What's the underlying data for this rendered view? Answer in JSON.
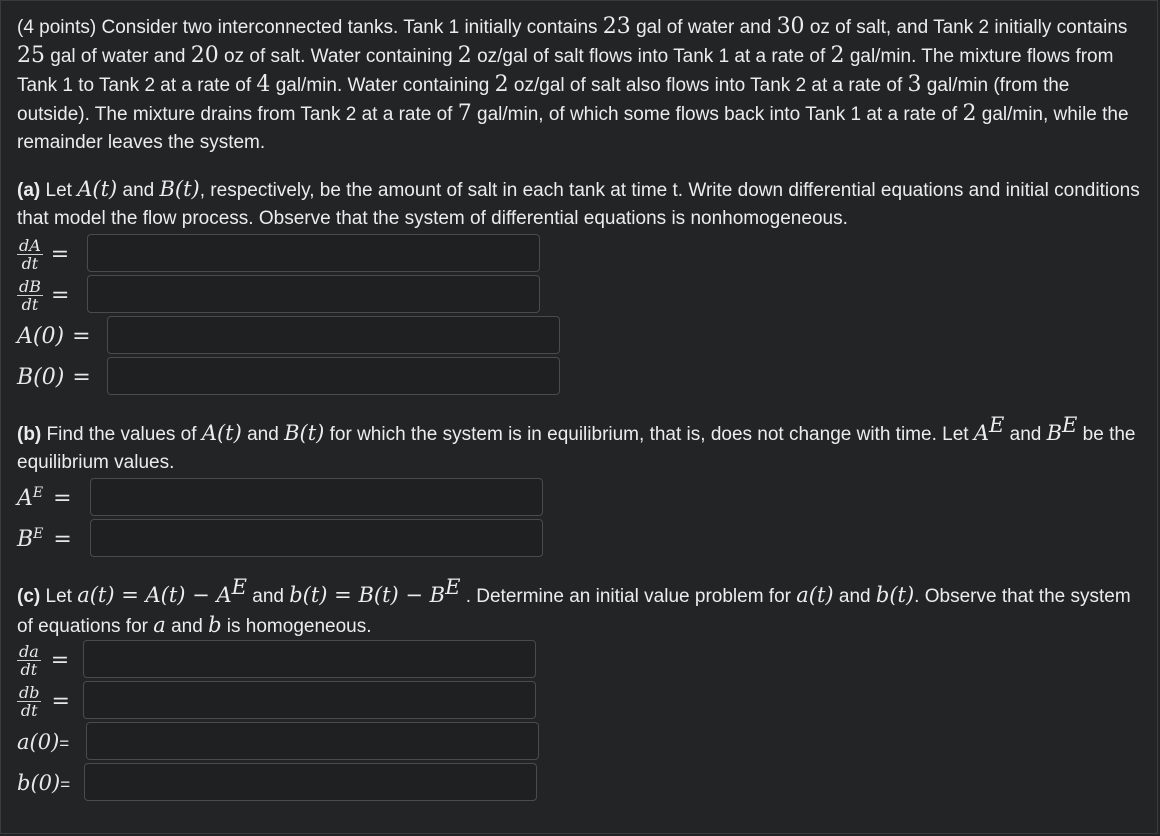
{
  "problem": {
    "intro": {
      "points": "(4 points)",
      "s1": " Consider two interconnected tanks. Tank 1 initially contains ",
      "n1": "23",
      "s2": " gal of water and ",
      "n2": "30",
      "s3": " oz of salt, and Tank 2 initially contains ",
      "n3": "25",
      "s4": " gal of water and ",
      "n4": "20",
      "s5": " oz of salt. Water containing ",
      "n5": "2",
      "s6": " oz/gal of salt flows into Tank 1 at a rate of ",
      "n6": "2",
      "s7": " gal/min. The mixture flows from Tank 1 to Tank 2 at a rate of ",
      "n7": "4",
      "s8": " gal/min. Water containing ",
      "n8": "2",
      "s9": " oz/gal of salt also flows into Tank 2 at a rate of ",
      "n9": "3",
      "s10": " gal/min (from the outside). The mixture drains from Tank 2 at a rate of ",
      "n10": "7",
      "s11": " gal/min, of which some flows back into Tank 1 at a rate of ",
      "n11": "2",
      "s12": " gal/min, while the remainder leaves the system."
    },
    "part_a": {
      "label": "(a)",
      "s1": " Let ",
      "A": "A(t)",
      "s2": " and ",
      "B": "B(t)",
      "s3": ", respectively, be the amount of salt in each tank at time t. Write down differential equations and initial conditions that model the flow process. Observe that the system of differential equations is nonhomogeneous.",
      "eq1_num": "dA",
      "eq1_den": "dt",
      "eq2_num": "dB",
      "eq2_den": "dt",
      "eq3": "A(0)",
      "eq4": "B(0)",
      "equals": "="
    },
    "part_b": {
      "label": "(b)",
      "s1": " Find the values of ",
      "A": "A(t)",
      "s2": " and ",
      "B": "B(t)",
      "s3": " for which the system is in equilibrium, that is, does not change with time. Let ",
      "AE_base": "A",
      "AE_sup": "E",
      "s4": " and ",
      "BE_base": "B",
      "BE_sup": "E",
      "s5": " be the equilibrium values.",
      "eq1_base": "A",
      "eq1_sup": "E",
      "eq2_base": "B",
      "eq2_sup": "E",
      "equals": "="
    },
    "part_c": {
      "label": "(c)",
      "s1": " Let ",
      "def_a": "a(t) = A(t) − A",
      "def_a_sup": "E",
      "s2": " and ",
      "def_b": "b(t) = B(t) − B",
      "def_b_sup": "E",
      "s3": " . Determine an initial value problem for ",
      "a": "a(t)",
      "s4": " and ",
      "b": "b(t)",
      "s5": ". Observe that the system of equations for ",
      "a2": "a",
      "s6": " and ",
      "b2": "b",
      "s7": " is homogeneous.",
      "eq1_num": "da",
      "eq1_den": "dt",
      "eq2_num": "db",
      "eq2_den": "dt",
      "eq3": "a(0)",
      "eq4": "b(0)",
      "equals": "=",
      "small_equals": "="
    }
  },
  "answers": {
    "dA_dt": "",
    "dB_dt": "",
    "A0": "",
    "B0": "",
    "AE": "",
    "BE": "",
    "da_dt": "",
    "db_dt": "",
    "a0": "",
    "b0": ""
  }
}
